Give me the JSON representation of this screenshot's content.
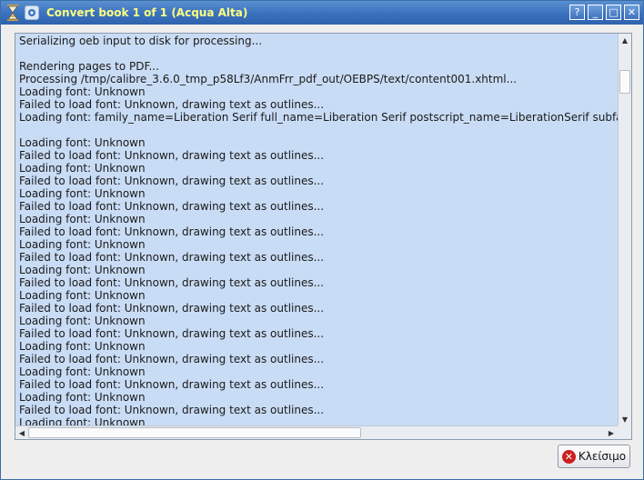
{
  "window": {
    "title": "Convert book 1 of 1 (Acqua Alta)",
    "buttons": {
      "help": "?",
      "minimize": "_",
      "maximize": "□",
      "close": "✕"
    }
  },
  "log": {
    "lines": [
      "Serializing oeb input to disk for processing...",
      "",
      "Rendering pages to PDF...",
      "Processing /tmp/calibre_3.6.0_tmp_p58Lf3/AnmFrr_pdf_out/OEBPS/text/content001.xhtml...",
      "Loading font: Unknown",
      "Failed to load font: Unknown, drawing text as outlines...",
      "Loading font: family_name=Liberation Serif full_name=Liberation Serif postscript_name=LiberationSerif subfamily_name=Regular a",
      "",
      "Loading font: Unknown",
      "Failed to load font: Unknown, drawing text as outlines...",
      "Loading font: Unknown",
      "Failed to load font: Unknown, drawing text as outlines...",
      "Loading font: Unknown",
      "Failed to load font: Unknown, drawing text as outlines...",
      "Loading font: Unknown",
      "Failed to load font: Unknown, drawing text as outlines...",
      "Loading font: Unknown",
      "Failed to load font: Unknown, drawing text as outlines...",
      "Loading font: Unknown",
      "Failed to load font: Unknown, drawing text as outlines...",
      "Loading font: Unknown",
      "Failed to load font: Unknown, drawing text as outlines...",
      "Loading font: Unknown",
      "Failed to load font: Unknown, drawing text as outlines...",
      "Loading font: Unknown",
      "Failed to load font: Unknown, drawing text as outlines...",
      "Loading font: Unknown",
      "Failed to load font: Unknown, drawing text as outlines...",
      "Loading font: Unknown",
      "Failed to load font: Unknown, drawing text as outlines...",
      "Loading font: Unknown",
      "Failed to load font: Unknown, drawing text as outlines...",
      "Loading font: Unknown"
    ]
  },
  "footer": {
    "close_label": "Κλείσιμο"
  },
  "colors": {
    "titlebar": "#3c73c0",
    "title_text": "#ffff80",
    "log_background": "#c9dcf5",
    "close_icon": "#cc1f1f"
  }
}
